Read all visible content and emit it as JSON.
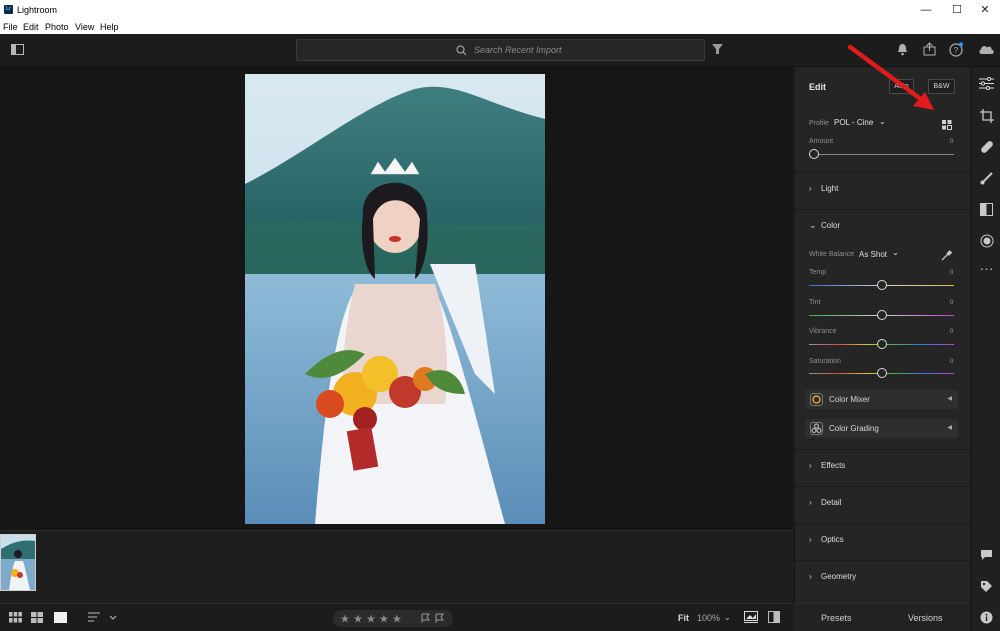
{
  "app": {
    "title": "Lightroom",
    "logo_text": "Lr"
  },
  "window_controls": {
    "minimize": "—",
    "maximize": "☐",
    "close": "✕"
  },
  "menu": [
    "File",
    "Edit",
    "Photo",
    "View",
    "Help"
  ],
  "toolbar": {
    "search_placeholder": "Search Recent Import"
  },
  "edit_panel": {
    "title": "Edit",
    "auto_label": "Auto",
    "bw_label": "B&W",
    "profile_label": "Profile",
    "profile_value": "POL - Cine",
    "amount_label": "Amount",
    "amount_value": "0",
    "sections": {
      "light": "Light",
      "color": "Color",
      "effects": "Effects",
      "detail": "Detail",
      "optics": "Optics",
      "geometry": "Geometry"
    },
    "white_balance_label": "White Balance",
    "white_balance_value": "As Shot",
    "sliders": [
      {
        "label": "Temp",
        "value": "0"
      },
      {
        "label": "Tint",
        "value": "0"
      },
      {
        "label": "Vibrance",
        "value": "0"
      },
      {
        "label": "Saturation",
        "value": "0"
      }
    ],
    "color_mixer": "Color Mixer",
    "color_grading": "Color Grading"
  },
  "bottom": {
    "zoom_fit": "Fit",
    "zoom_percent": "100%"
  },
  "footer": {
    "presets": "Presets",
    "versions": "Versions"
  },
  "colors": {
    "accent_arrow": "#e01b1b",
    "panel_bg": "#252525",
    "canvas_bg": "#161616"
  }
}
